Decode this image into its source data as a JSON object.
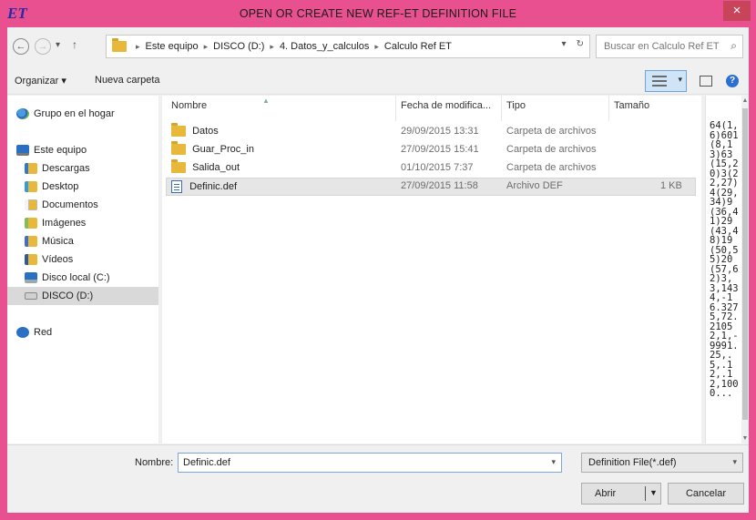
{
  "window": {
    "app_logo": "ET",
    "title": "OPEN OR CREATE NEW REF-ET DEFINITION FILE",
    "close_label": "×"
  },
  "address_bar": {
    "back": "←",
    "forward": "→",
    "up": "↑",
    "crumbs": [
      "Este equipo",
      "DISCO (D:)",
      "4. Datos_y_calculos",
      "Calculo Ref ET"
    ],
    "refresh": "↻",
    "search_placeholder": "Buscar en Calculo Ref ET"
  },
  "toolbar": {
    "organize_label": "Organizar ▾",
    "new_folder_label": "Nueva carpeta",
    "help_label": "?"
  },
  "nav_pane": {
    "items": [
      {
        "label": "Grupo en el hogar",
        "icon": "homegroup-icon"
      },
      {
        "label": "Este equipo",
        "icon": "computer-icon"
      },
      {
        "label": "Descargas",
        "icon": "downloads-folder-icon"
      },
      {
        "label": "Desktop",
        "icon": "desktop-folder-icon"
      },
      {
        "label": "Documentos",
        "icon": "documents-folder-icon"
      },
      {
        "label": "Imágenes",
        "icon": "pictures-folder-icon"
      },
      {
        "label": "Música",
        "icon": "music-folder-icon"
      },
      {
        "label": "Vídeos",
        "icon": "videos-folder-icon"
      },
      {
        "label": "Disco local (C:)",
        "icon": "local-disk-icon"
      },
      {
        "label": "DISCO (D:)",
        "icon": "drive-icon"
      },
      {
        "label": "Red",
        "icon": "network-icon"
      }
    ]
  },
  "file_list": {
    "columns": [
      "Nombre",
      "Fecha de modifica...",
      "Tipo",
      "Tamaño"
    ],
    "rows": [
      {
        "name": "Datos",
        "date": "29/09/2015 13:31",
        "type": "Carpeta de archivos",
        "size": "",
        "icon": "folder-icon"
      },
      {
        "name": "Guar_Proc_in",
        "date": "27/09/2015 15:41",
        "type": "Carpeta de archivos",
        "size": "",
        "icon": "folder-icon"
      },
      {
        "name": "Salida_out",
        "date": "01/10/2015 7:37",
        "type": "Carpeta de archivos",
        "size": "",
        "icon": "folder-icon"
      },
      {
        "name": "Definic.def",
        "date": "27/09/2015 11:58",
        "type": "Archivo DEF",
        "size": "1 KB",
        "icon": "def-file-icon"
      }
    ]
  },
  "preview": {
    "text": "64(1,6)601(8,13)63(15,20)3(22,27)4(29,34)9(36,41)29(43,48)19(50,55)20(57,62)3,3,1434,-16.3275,72.21052,1,-9991.25,.5,.12,.12,1000..."
  },
  "bottom": {
    "name_label": "Nombre:",
    "name_value": "Definic.def",
    "filter_value": "Definition File(*.def)",
    "open_label": "Abrir",
    "cancel_label": "Cancelar"
  },
  "colors": {
    "title_bar": "#e8508f",
    "close_button": "#c8445a",
    "selection": "#e6e6e6",
    "view_button": "#cfe4f7"
  }
}
